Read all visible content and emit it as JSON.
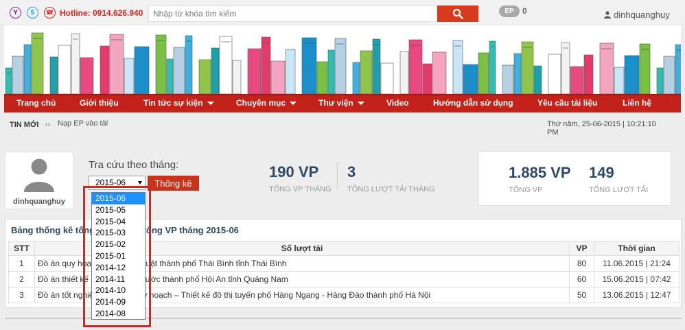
{
  "topbar": {
    "hotline": "Hotline: 0914.626.940",
    "search_placeholder": "Nhập từ khóa tìm kiếm",
    "ep_label": "EP",
    "ep_count": "0",
    "username": "dinhquanghuy"
  },
  "nav": {
    "items": [
      {
        "label": "Trang chủ"
      },
      {
        "label": "Giới thiệu"
      },
      {
        "label": "Tin tức sự kiện"
      },
      {
        "label": "Chuyên mục"
      },
      {
        "label": "Thư viện"
      },
      {
        "label": "Video"
      },
      {
        "label": "Hướng dẫn sử dụng"
      },
      {
        "label": "Yêu cầu tài liệu"
      },
      {
        "label": "Liên hệ"
      }
    ]
  },
  "ticker": {
    "label": "TIN MỚI",
    "arrows": "‹›",
    "text": "Nạp EP vào tài khoản"
  },
  "datetime": "Thứ năm, 25-06-2015 | 10:21:10 PM",
  "profile": {
    "name": "dinhquanghuy"
  },
  "lookup": {
    "label": "Tra cứu theo tháng:",
    "selected_month": "2015-06",
    "button": "Thống kê",
    "options": [
      "2015-06",
      "2015-05",
      "2015-04",
      "2015-03",
      "2015-02",
      "2015-01",
      "2014-12",
      "2014-11",
      "2014-10",
      "2014-09",
      "2014-08"
    ]
  },
  "monthly": {
    "vp_value": "190 VP",
    "vp_label": "TỔNG VP THÁNG",
    "downloads_value": "3",
    "downloads_label": "TỔNG LƯỢT TẢI THÁNG"
  },
  "totals": {
    "vp_value": "1.885 VP",
    "vp_label": "TỔNG VP",
    "downloads_value": "149",
    "downloads_label": "TỔNG LƯỢT TẢI"
  },
  "table": {
    "title": "Bảng thống kê tổng lượt tải và tổng VP tháng 2015-06",
    "headers": {
      "stt": "STT",
      "title": "Số lượt tải",
      "vp": "VP",
      "time": "Thời gian"
    },
    "rows": [
      {
        "stt": "1",
        "title": "Đồ án quy hoạch chi tiết khu luật thành phố Thái Bình tỉnh Thái Bình",
        "vp": "80",
        "time": "11.06.2015 | 21:24"
      },
      {
        "stt": "2",
        "title": "Đồ án thiết kế hệ thống cấp nước thành phố Hội An tỉnh Quảng Nam",
        "vp": "60",
        "time": "15.06.2015 | 07:42"
      },
      {
        "stt": "3",
        "title": "Đồ án tốt nghiệp kiến trúc quy hoạch – Thiết kế đô thị tuyến phố Hàng Ngang - Hàng Đào thành phố Hà Nội",
        "vp": "50",
        "time": "13.06.2015 | 12:47"
      }
    ]
  },
  "colors": {
    "brand_red": "#c2221a",
    "navy": "#2c4a66",
    "select_blue": "#1e90ff"
  }
}
